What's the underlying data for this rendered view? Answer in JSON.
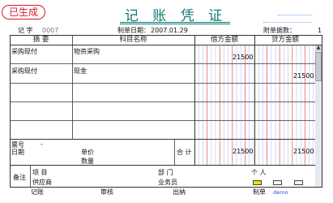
{
  "stamp": "已生成",
  "title": "记 账 凭 证",
  "voucher_label": "记 字",
  "voucher_no": "0007",
  "date_label": "制单日期：",
  "date_value": "2007.01.29",
  "attach_label": "附单据数：",
  "attach_value": "1",
  "headers": {
    "summary": "摘 要",
    "account": "科目名称",
    "debit": "借方金额",
    "credit": "贷方金额"
  },
  "rows": [
    {
      "summary": "采购现付",
      "account": "物资采购",
      "debit": "21500",
      "credit": ""
    },
    {
      "summary": "采购现付",
      "account": "现金",
      "debit": "",
      "credit": "21500"
    }
  ],
  "footer": {
    "ticket_label": "票号",
    "ticket_dash": "-",
    "date_label": "日期",
    "price_label": "单价",
    "qty_label": "数量",
    "total_label": "合 计",
    "total_debit": "21500",
    "total_credit": "21500",
    "remark_label": "备注",
    "project_label": "项  目",
    "dept_label": "部  门",
    "person_label": "个  人",
    "supplier_label": "供应商",
    "salesman_label": "业务员"
  },
  "signatures": {
    "bookkeep": "记账",
    "audit": "审核",
    "cashier": "出纳",
    "maker_label": "制单",
    "maker_value": "demo"
  },
  "colors": {
    "stamp": "#d8152b",
    "title": "#0f7a72",
    "grid_blue": "#3a5fd0",
    "grid_red": "#d23030"
  }
}
